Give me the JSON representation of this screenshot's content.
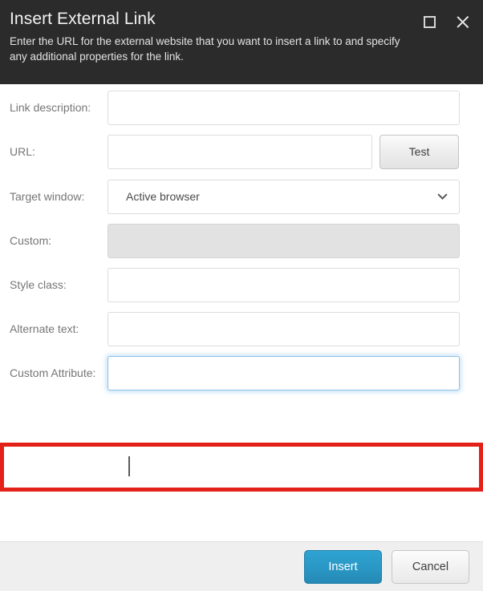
{
  "dialog": {
    "title": "Insert External Link",
    "description": "Enter the URL for the external website that you want to insert a link to and specify any additional properties for the link.",
    "window_controls": {
      "maximize": "maximize-icon",
      "close": "close-icon"
    }
  },
  "form": {
    "fields": [
      {
        "label": "Link description:",
        "type": "text",
        "value": "",
        "placeholder": "",
        "name": "link-description"
      },
      {
        "label": "URL:",
        "type": "text",
        "value": "",
        "placeholder": "",
        "name": "url"
      },
      {
        "label": "Target window:",
        "type": "select",
        "value": "Active browser",
        "name": "target-window"
      },
      {
        "label": "Custom:",
        "type": "text",
        "value": "",
        "placeholder": "",
        "disabled": true,
        "name": "custom"
      },
      {
        "label": "Style class:",
        "type": "text",
        "value": "",
        "placeholder": "",
        "name": "style-class"
      },
      {
        "label": "Alternate text:",
        "type": "text",
        "value": "",
        "placeholder": "",
        "name": "alternate-text"
      },
      {
        "label": "Custom Attribute:",
        "type": "text",
        "value": "",
        "placeholder": "",
        "focused": true,
        "name": "custom-attribute"
      }
    ],
    "test_button_label": "Test",
    "dropdown_icon": "chevron-down-icon"
  },
  "footer": {
    "primary_label": "Insert",
    "secondary_label": "Cancel"
  },
  "annotation": {
    "highlight_color": "#e32119",
    "target_field": "Custom Attribute:"
  },
  "colors": {
    "header_background": "#2b2b2b",
    "accent_blue": "#2a97c4",
    "footer_background": "#efefef",
    "disabled_field": "#e2e2e2",
    "focus_border": "#8fc2e8"
  }
}
